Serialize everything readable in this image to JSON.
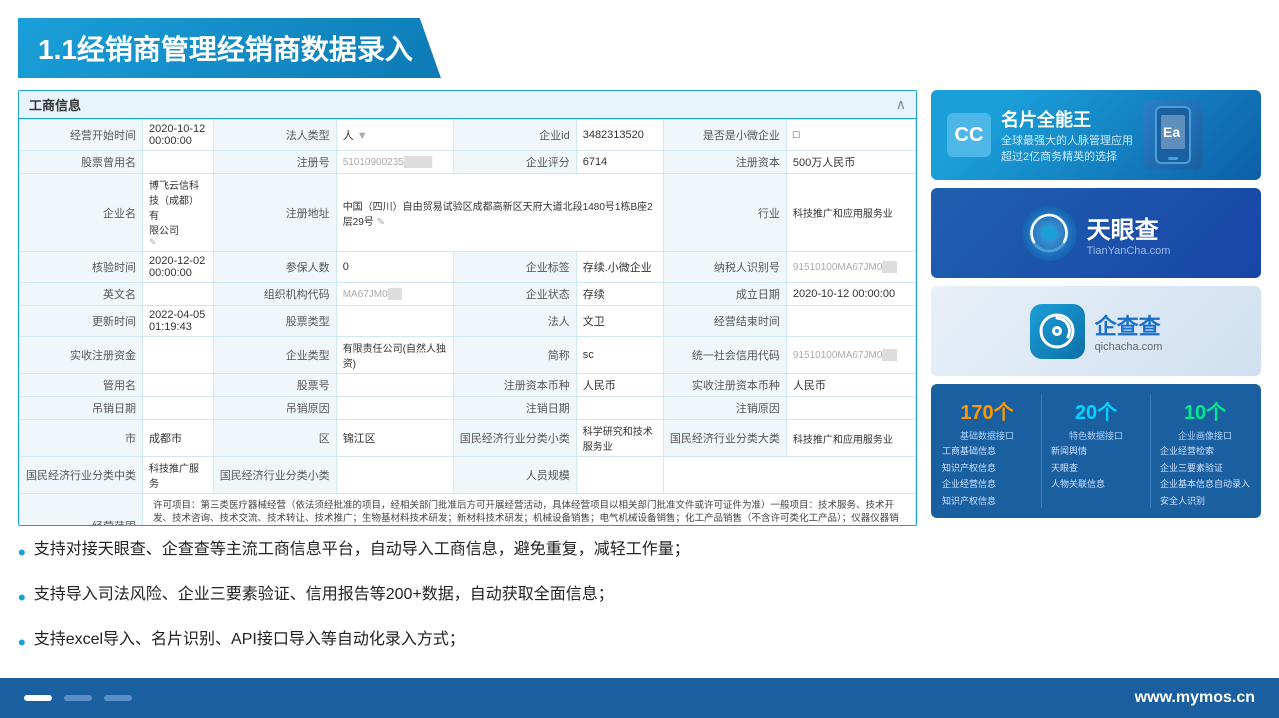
{
  "header": {
    "title": "1.1经销商管理经销商数据录入"
  },
  "form_card": {
    "header_title": "工商信息",
    "rows": [
      {
        "cells": [
          {
            "label": "经营开始时间",
            "value": "2020-10-12 00:00:00"
          },
          {
            "label": "法人类型",
            "value": "人"
          },
          {
            "label": "企业id",
            "value": "3482313520"
          },
          {
            "label": "是否是小微企业",
            "value": "□"
          }
        ]
      },
      {
        "cells": [
          {
            "label": "股票曾用名",
            "value": ""
          },
          {
            "label": "注册号",
            "value": "51010900235..."
          },
          {
            "label": "企业评分",
            "value": "6714"
          },
          {
            "label": "注册资本",
            "value": "500万人民币"
          }
        ]
      },
      {
        "cells": [
          {
            "label": "企业名",
            "value": "博飞云信科技（成都）有限公司"
          },
          {
            "label": "注册地址",
            "value": "中国（四川）自由贸易试验区成都高新区天府大道北段1480号1栋B座2层29号"
          },
          {
            "label": "行业",
            "value": "科技推广和应用服务业"
          }
        ]
      },
      {
        "cells": [
          {
            "label": "核验时间",
            "value": "2020-12-02 00:00:00"
          },
          {
            "label": "参保人数",
            "value": "0"
          },
          {
            "label": "企业标签",
            "value": "存续.小微企业"
          },
          {
            "label": "纳税人识别号",
            "value": "91510100MA67JM0..."
          }
        ]
      },
      {
        "cells": [
          {
            "label": "英文名",
            "value": ""
          },
          {
            "label": "组织机构代码",
            "value": "MA67JM0..."
          },
          {
            "label": "企业状态",
            "value": "存续"
          },
          {
            "label": "成立日期",
            "value": "2020-10-12 00:00:00"
          }
        ]
      },
      {
        "cells": [
          {
            "label": "更新时间",
            "value": "2022-04-05 01:19:43"
          },
          {
            "label": "股票类型",
            "value": ""
          },
          {
            "label": "法人",
            "value": "文卫"
          },
          {
            "label": "经营结束时间",
            "value": ""
          }
        ]
      },
      {
        "cells": [
          {
            "label": "实收注册资金",
            "value": ""
          },
          {
            "label": "企业类型",
            "value": "有限责任公司(自然人独资)"
          },
          {
            "label": "简称",
            "value": "sc"
          },
          {
            "label": "统一社会信用代码",
            "value": "91510100MA67JM0..."
          }
        ]
      },
      {
        "cells": [
          {
            "label": "管用名",
            "value": ""
          },
          {
            "label": "股票号",
            "value": ""
          },
          {
            "label": "注册资本币种",
            "value": "人民币"
          },
          {
            "label": "实收注册资本币种",
            "value": "人民币"
          }
        ]
      },
      {
        "cells": [
          {
            "label": "吊销日期",
            "value": ""
          },
          {
            "label": "吊销原因",
            "value": ""
          },
          {
            "label": "注销日期",
            "value": ""
          },
          {
            "label": "注销原因",
            "value": ""
          }
        ]
      },
      {
        "cells": [
          {
            "label": "市",
            "value": "成都市"
          },
          {
            "label": "区",
            "value": "锦江区"
          },
          {
            "label": "国民经济行业分类小类",
            "value": "科学研究和技术服务业"
          },
          {
            "label": "国民经济行业分类大类",
            "value": "科技推广和应用服务业"
          }
        ]
      },
      {
        "cells": [
          {
            "label": "国民经济行业分类中类",
            "value": "科技推广服务"
          },
          {
            "label": "国民经济行业分类小类2",
            "value": ""
          },
          {
            "label": "人员规模",
            "value": ""
          }
        ]
      }
    ],
    "business_scope_label": "经营范围",
    "business_scope_text": "许可项目：第三类医疗器械经营（依法须经批准的项目，经相关部门批准后方可开展经营活动，具体经营项目以相关部门批准文件或许可证件为准）一般项目：技术服务、技术开发、技术咨询、技术交流、技术转让、技术推广；生物基材料技术研发；新材料技术研发；机械设备销售；电气机械设备销售；化工产品销售（不含许可类化工产品）；仪器仪器销售；第一类医疗器械销售；第二类医疗器械销售；化妆品零售；计算机软硬件及辅助设备零售；通讯设备销售；技术进出口；货物进出口；家用电器销售；日用家电零售；电子产品销售；专用化学产品销售（不含危险化学品）（除依法须经批准的项目外，凭营业执照依法自主开展经营活动）。"
  },
  "bullets": [
    "支持对接天眼查、企查查等主流工商信息平台，自动导入工商信息，避免重复，减轻工作量；",
    "支持导入司法风险、企业三要素验证、信用报告等200+数据，自动获取全面信息；",
    "支持excel导入、名片识别、API接口导入等自动化录入方式；"
  ],
  "ads": {
    "mingpian": {
      "cc_label": "CC",
      "title": "名片全能王",
      "subtitle1": "全球最强大的人脉管理应用",
      "subtitle2": "超过2亿商务精英的选择"
    },
    "tianyanzha": {
      "title": "天眼查",
      "url": "TianYanCha.com"
    },
    "qichacha": {
      "title": "企查查",
      "url": "qichacha.com"
    }
  },
  "stats": {
    "col1": {
      "count": "170个",
      "label": "基础数据接口",
      "items": [
        "工商基础信息",
        "知识产权信息",
        "企业经营信息",
        "知识产权信息"
      ]
    },
    "col2": {
      "count": "20个",
      "label": "特色数据接口",
      "items": [
        "新闻舆情",
        "天眼查",
        "人物关联信息"
      ]
    },
    "col3": {
      "count": "10个",
      "label": "企业画像接口",
      "items": [
        "企业经营检索",
        "企业三要素验证",
        "企业基本信息自动录入",
        "安全人识别"
      ]
    }
  },
  "footer": {
    "url": "www.mymos.cn",
    "dots": [
      "active",
      "inactive",
      "inactive"
    ]
  }
}
